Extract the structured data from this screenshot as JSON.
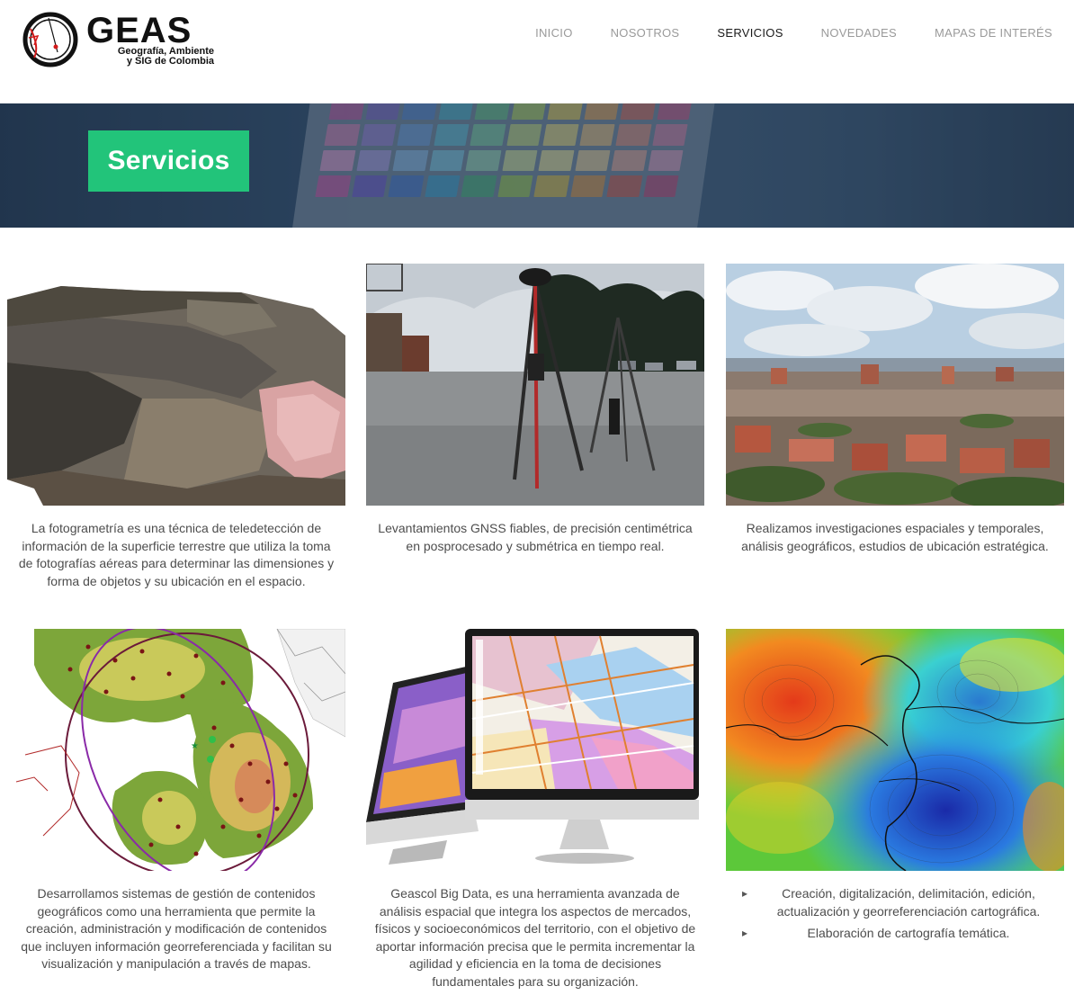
{
  "brand": {
    "name": "GEAS",
    "tagline_line1": "Geografía, Ambiente",
    "tagline_line2": "y SIG de Colombia"
  },
  "nav": {
    "items": [
      {
        "label": "INICIO",
        "active": false
      },
      {
        "label": "NOSOTROS",
        "active": false
      },
      {
        "label": "SERVICIOS",
        "active": true
      },
      {
        "label": "NOVEDADES",
        "active": false
      },
      {
        "label": "MAPAS DE INTERÉS",
        "active": false
      }
    ]
  },
  "banner": {
    "title": "Servicios",
    "accent_color": "#22c47a"
  },
  "services": [
    {
      "image": "photogrammetry-3d-model",
      "text": "La fotogrametría es una técnica de teledetección de información de la superficie terrestre que utiliza la toma de fotografías aéreas para determinar las dimensiones y forma de objetos y su ubicación en el espacio."
    },
    {
      "image": "gnss-tripod-photo",
      "text": "Levantamientos GNSS fiables, de precisión centimétrica en posprocesado y submétrica en tiempo real."
    },
    {
      "image": "city-aerial-photo",
      "text": "Realizamos investigaciones espaciales y temporales, análisis geográficos, estudios de ubicación estratégica."
    },
    {
      "image": "gis-map-with-circles",
      "text": "Desarrollamos sistemas de gestión de contenidos geográficos como una herramienta que permite la creación, administración y modificación de contenidos que incluyen información georreferenciada y facilitan su visualización y manipulación a través de mapas."
    },
    {
      "image": "monitors-with-maps",
      "text": "Geascol Big Data, es una herramienta avanzada de análisis espacial que integra los aspectos de mercados, físicos y socioeconómicos del territorio, con el objetivo de aportar información precisa que le permita incrementar la agilidad y eficiencia en la toma de decisiones fundamentales para su organización."
    },
    {
      "image": "thematic-heatmap",
      "bullets": [
        "Creación, digitalización, delimitación, edición, actualización y georreferenciación cartográfica.",
        "Elaboración de cartografía temática."
      ]
    }
  ]
}
